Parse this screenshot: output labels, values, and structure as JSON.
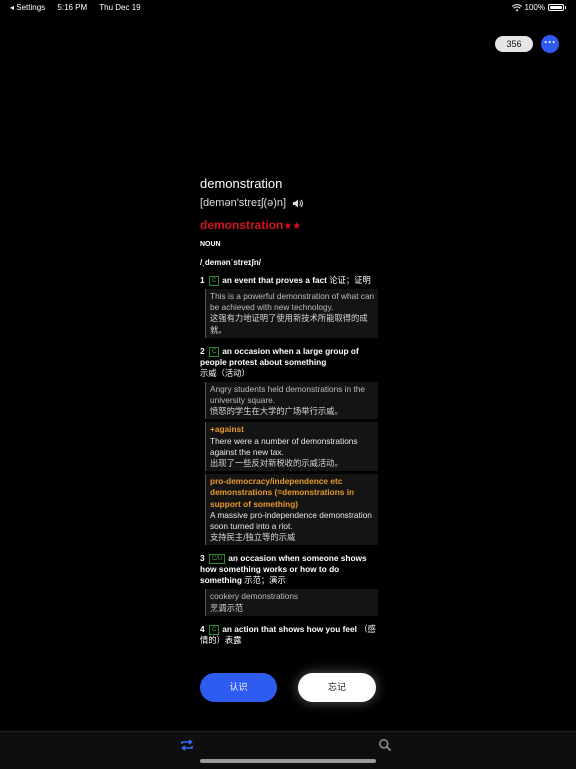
{
  "status": {
    "back_label": "◂ Settings",
    "time": "5:16 PM",
    "date": "Thu Dec 19",
    "battery": "100%"
  },
  "header": {
    "count": "356",
    "more_glyph": "···"
  },
  "word": {
    "headword": "demonstration",
    "phonetic": "[demən'streɪʃ(ə)n]"
  },
  "entry": {
    "title": "demonstration",
    "stars": "★★",
    "pos": "NOUN",
    "ipa": "/ˌdemənˈstreɪʃn/"
  },
  "senses": [
    {
      "num": "1",
      "badge": "C",
      "def": "an event that proves a fact",
      "zh": "论证；证明",
      "examples": [
        {
          "en": "This is a powerful demonstration of what can be achieved with new technology.",
          "zh": "这强有力地证明了使用新技术所能取得的成就。"
        }
      ]
    },
    {
      "num": "2",
      "badge": "C",
      "def": "an occasion when a large group of people protest about something",
      "zh": "示威（活动）",
      "examples": [
        {
          "en": "Angry students held demonstrations in the university square.",
          "zh": "愤怒的学生在大学的广场举行示威。"
        },
        {
          "pattern": "+against",
          "en": "There were a number of demonstrations against the new tax.",
          "zh": "出现了一些反对新税收的示威活动。"
        },
        {
          "pattern": "pro-democracy/independence etc demonstrations (=demonstrations in support of something)",
          "en": "A massive pro-independence demonstration soon turned into a riot.",
          "zh": "支持民主/独立等的示威"
        }
      ]
    },
    {
      "num": "3",
      "badge": "C/U",
      "def": "an occasion when someone shows how something works or how to do something",
      "zh": "示范；演示",
      "examples": [
        {
          "en": "cookery demonstrations",
          "zh": "烹调示范"
        }
      ]
    },
    {
      "num": "4",
      "badge": "C",
      "def": "an action that shows how you feel",
      "zh": "（感情的）表露",
      "examples": []
    }
  ],
  "actions": {
    "know_label": "认识",
    "forget_label": "忘记"
  },
  "tabs": [
    {
      "name": "review",
      "icon": "repeat-icon",
      "active": true,
      "color": "#2f6cf5"
    },
    {
      "name": "search",
      "icon": "search-icon",
      "active": false,
      "color": "#8a8a8a"
    }
  ]
}
